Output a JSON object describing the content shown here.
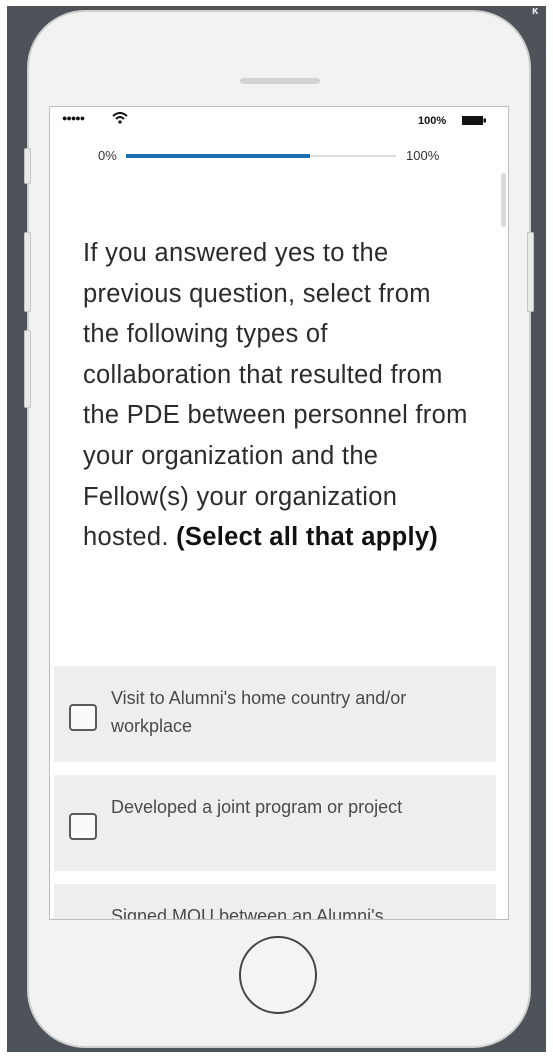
{
  "status_bar": {
    "signal": "●●●●●",
    "battery": "100%"
  },
  "progress": {
    "min_label": "0%",
    "max_label": "100%",
    "fraction": 0.68
  },
  "question": {
    "text": "If you answered yes to the previous question, select from the following types of collaboration that resulted from the PDE between personnel from your organization and the Fellow(s) your organization hosted.",
    "instruction": "(Select all that apply)"
  },
  "options": [
    {
      "label": "Visit to Alumni's home country and/or workplace"
    },
    {
      "label": "Developed a joint program or project"
    },
    {
      "label": "Signed MOU between an Alumni's"
    }
  ],
  "icons": {
    "wifi": "wifi-icon",
    "battery": "battery-icon",
    "checkbox": "checkbox-icon",
    "home": "home-button-icon"
  },
  "colors": {
    "progress_fill": "#1d6fb1",
    "frame_background": "#4d5358",
    "option_background": "#eeeeee"
  }
}
